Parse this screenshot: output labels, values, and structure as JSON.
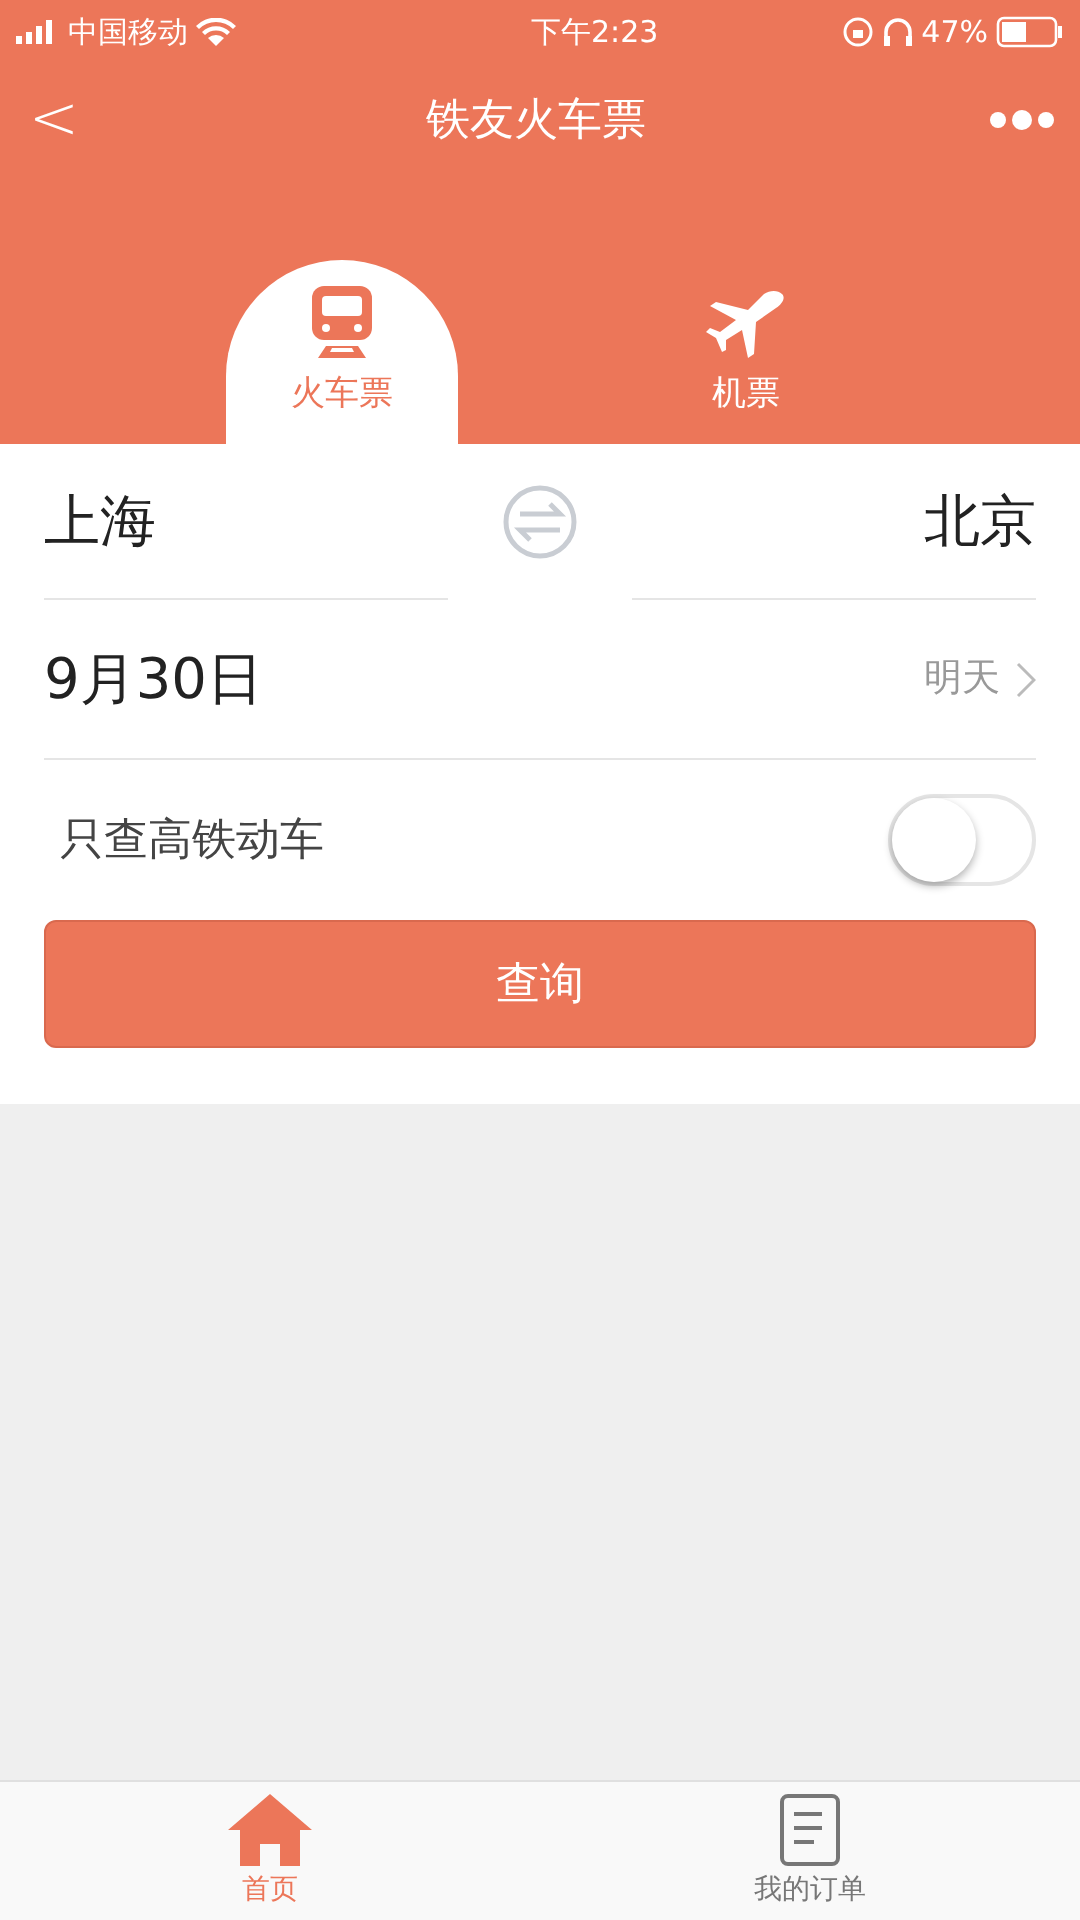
{
  "status_bar": {
    "carrier": "中国移动",
    "time": "下午2:23",
    "battery": "47%"
  },
  "nav": {
    "back": "<",
    "title": "铁友火车票"
  },
  "mode_tabs": [
    {
      "kind": "train",
      "label": "火车票",
      "selected": true
    },
    {
      "kind": "plane",
      "label": "机票",
      "selected": false
    }
  ],
  "route": {
    "from": "上海",
    "to": "北京"
  },
  "date": {
    "value": "9月30日",
    "hint": "明天"
  },
  "filter": {
    "label": "只查高铁动车",
    "on": false
  },
  "search_button": "查询",
  "bottom_tabs": [
    {
      "kind": "home",
      "label": "首页",
      "selected": true
    },
    {
      "kind": "orders",
      "label": "我的订单",
      "selected": false
    }
  ]
}
